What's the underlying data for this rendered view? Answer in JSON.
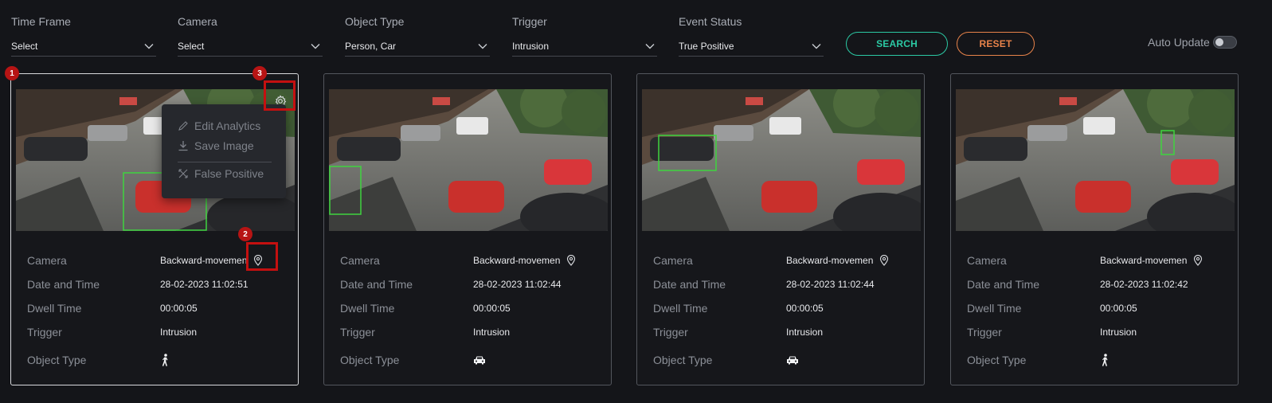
{
  "filters": {
    "time_frame": {
      "label": "Time Frame",
      "value": "Select"
    },
    "camera": {
      "label": "Camera",
      "value": "Select"
    },
    "object_type": {
      "label": "Object Type",
      "value": "Person, Car"
    },
    "trigger": {
      "label": "Trigger",
      "value": "Intrusion"
    },
    "event_status": {
      "label": "Event Status",
      "value": "True Positive"
    }
  },
  "buttons": {
    "search": "SEARCH",
    "reset": "RESET"
  },
  "auto_update": {
    "label": "Auto Update",
    "enabled": false
  },
  "field_labels": {
    "camera": "Camera",
    "date_time": "Date and Time",
    "dwell_time": "Dwell Time",
    "trigger": "Trigger",
    "object_type": "Object Type"
  },
  "cards": [
    {
      "camera": "Backward-movemen",
      "date_time": "28-02-2023 11:02:51",
      "dwell_time": "00:00:05",
      "trigger": "Intrusion",
      "object_type_icon": "person-icon"
    },
    {
      "camera": "Backward-movemen",
      "date_time": "28-02-2023 11:02:44",
      "dwell_time": "00:00:05",
      "trigger": "Intrusion",
      "object_type_icon": "car-icon"
    },
    {
      "camera": "Backward-movemen",
      "date_time": "28-02-2023 11:02:44",
      "dwell_time": "00:00:05",
      "trigger": "Intrusion",
      "object_type_icon": "car-icon"
    },
    {
      "camera": "Backward-movemen",
      "date_time": "28-02-2023 11:02:42",
      "dwell_time": "00:00:05",
      "trigger": "Intrusion",
      "object_type_icon": "person-icon"
    }
  ],
  "context_menu": {
    "edit_analytics": "Edit Analytics",
    "save_image": "Save Image",
    "false_positive": "False Positive"
  },
  "annotations": {
    "badge_1": "1",
    "badge_2": "2",
    "badge_3": "3"
  },
  "colors": {
    "accent_search": "#2bc9a4",
    "accent_reset": "#e8834a",
    "annotation_red": "#c41010",
    "detection_box": "#3fd43f"
  }
}
